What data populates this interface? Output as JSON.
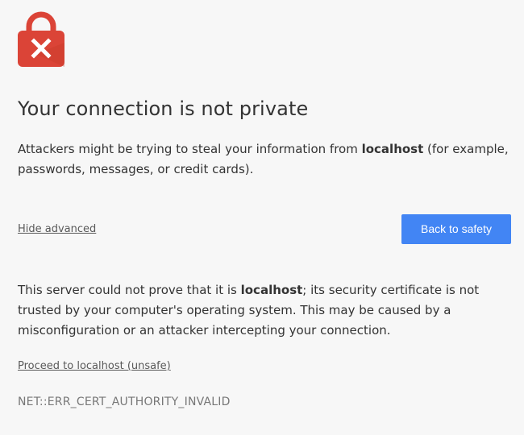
{
  "page": {
    "icon": "lock-error-icon",
    "accent_color": "#db4437",
    "button_color": "#4285f4",
    "heading": "Your connection is not private",
    "main_message": {
      "prefix": "Attackers might be trying to steal your information from ",
      "host": "localhost",
      "suffix": " (for example, passwords, messages, or credit cards)."
    },
    "hide_advanced_label": "Hide advanced",
    "back_button_label": "Back to safety",
    "details": {
      "prefix": "This server could not prove that it is ",
      "host": "localhost",
      "suffix": "; its security certificate is not trusted by your computer's operating system. This may be caused by a misconfiguration or an attacker intercepting your connection."
    },
    "proceed_label": "Proceed to localhost (unsafe)",
    "error_code": "NET::ERR_CERT_AUTHORITY_INVALID"
  }
}
